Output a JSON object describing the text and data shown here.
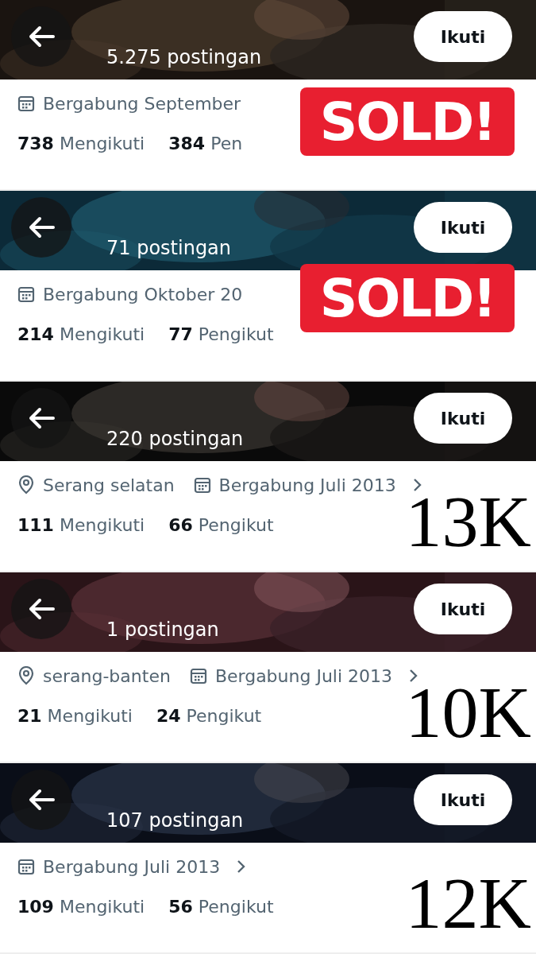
{
  "profiles": [
    {
      "posts": "5.275 postingan",
      "follow_button": "Ikuti",
      "joined": "Bergabung September",
      "following_count": "738",
      "following_label": "Mengikuti",
      "followers_count": "384",
      "followers_label": "Pen",
      "stamp": "SOLD!"
    },
    {
      "posts": "71 postingan",
      "follow_button": "Ikuti",
      "joined": "Bergabung Oktober 20",
      "following_count": "214",
      "following_label": "Mengikuti",
      "followers_count": "77",
      "followers_label": "Pengikut",
      "stamp": "SOLD!"
    },
    {
      "posts": "220 postingan",
      "follow_button": "Ikuti",
      "location": "Serang selatan",
      "joined": "Bergabung Juli 2013",
      "more": true,
      "following_count": "111",
      "following_label": "Mengikuti",
      "followers_count": "66",
      "followers_label": "Pengikut",
      "price": "13K"
    },
    {
      "posts": "1 postingan",
      "follow_button": "Ikuti",
      "location": "serang-banten",
      "joined": "Bergabung Juli 2013",
      "more": true,
      "following_count": "21",
      "following_label": "Mengikuti",
      "followers_count": "24",
      "followers_label": "Pengikut",
      "price": "10K"
    },
    {
      "posts": "107 postingan",
      "follow_button": "Ikuti",
      "joined": "Bergabung Juli 2013",
      "more": true,
      "following_count": "109",
      "following_label": "Mengikuti",
      "followers_count": "56",
      "followers_label": "Pengikut",
      "price": "12K"
    }
  ]
}
